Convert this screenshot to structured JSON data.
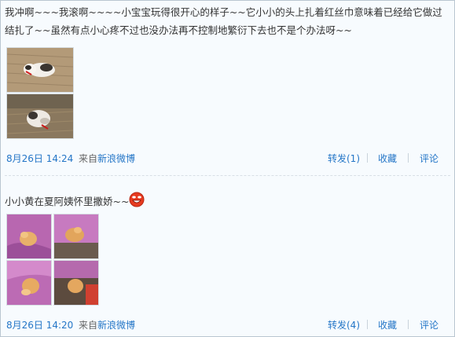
{
  "posts": [
    {
      "text": "我冲啊~~~我滚啊~~~~小宝宝玩得很开心的样子~~它小小的头上扎着红丝巾意味着已经给它做过结扎了~~虽然有点小心疼不过也没办法再不控制地繁衍下去也不是个办法呀~~",
      "time": "8月26日  14:24",
      "source_label": "来自",
      "source": "新浪微博",
      "repost": "转发(1)",
      "favorite": "收藏",
      "comment": "评论"
    },
    {
      "text": "小小黄在夏阿姨怀里撒娇~~",
      "time": "8月26日  14:20",
      "source_label": "来自",
      "source": "新浪微博",
      "repost": "转发(4)",
      "favorite": "收藏",
      "comment": "评论",
      "emoji_icon": "laughing-face-icon"
    }
  ]
}
